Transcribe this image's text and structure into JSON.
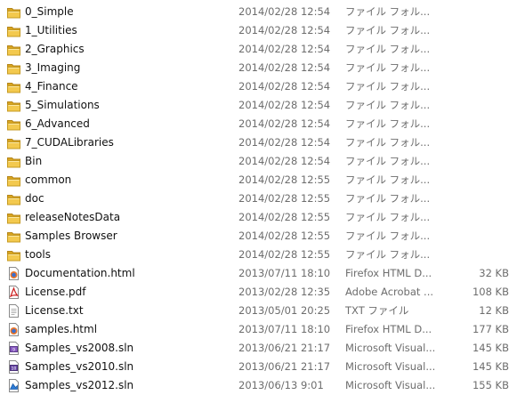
{
  "files": [
    {
      "name": "0_Simple",
      "date": "2014/02/28 12:54",
      "type": "ファイル フォル...",
      "size": "",
      "icon": "folder-icon"
    },
    {
      "name": "1_Utilities",
      "date": "2014/02/28 12:54",
      "type": "ファイル フォル...",
      "size": "",
      "icon": "folder-icon"
    },
    {
      "name": "2_Graphics",
      "date": "2014/02/28 12:54",
      "type": "ファイル フォル...",
      "size": "",
      "icon": "folder-icon"
    },
    {
      "name": "3_Imaging",
      "date": "2014/02/28 12:54",
      "type": "ファイル フォル...",
      "size": "",
      "icon": "folder-icon"
    },
    {
      "name": "4_Finance",
      "date": "2014/02/28 12:54",
      "type": "ファイル フォル...",
      "size": "",
      "icon": "folder-icon"
    },
    {
      "name": "5_Simulations",
      "date": "2014/02/28 12:54",
      "type": "ファイル フォル...",
      "size": "",
      "icon": "folder-icon"
    },
    {
      "name": "6_Advanced",
      "date": "2014/02/28 12:54",
      "type": "ファイル フォル...",
      "size": "",
      "icon": "folder-icon"
    },
    {
      "name": "7_CUDALibraries",
      "date": "2014/02/28 12:54",
      "type": "ファイル フォル...",
      "size": "",
      "icon": "folder-icon"
    },
    {
      "name": "Bin",
      "date": "2014/02/28 12:54",
      "type": "ファイル フォル...",
      "size": "",
      "icon": "folder-icon"
    },
    {
      "name": "common",
      "date": "2014/02/28 12:55",
      "type": "ファイル フォル...",
      "size": "",
      "icon": "folder-icon"
    },
    {
      "name": "doc",
      "date": "2014/02/28 12:55",
      "type": "ファイル フォル...",
      "size": "",
      "icon": "folder-icon"
    },
    {
      "name": "releaseNotesData",
      "date": "2014/02/28 12:55",
      "type": "ファイル フォル...",
      "size": "",
      "icon": "folder-icon"
    },
    {
      "name": "Samples Browser",
      "date": "2014/02/28 12:55",
      "type": "ファイル フォル...",
      "size": "",
      "icon": "folder-icon"
    },
    {
      "name": "tools",
      "date": "2014/02/28 12:55",
      "type": "ファイル フォル...",
      "size": "",
      "icon": "folder-icon"
    },
    {
      "name": "Documentation.html",
      "date": "2013/07/11 18:10",
      "type": "Firefox HTML D...",
      "size": "32 KB",
      "icon": "html-file-icon"
    },
    {
      "name": "License.pdf",
      "date": "2013/02/28 12:35",
      "type": "Adobe Acrobat ...",
      "size": "108 KB",
      "icon": "pdf-file-icon"
    },
    {
      "name": "License.txt",
      "date": "2013/05/01 20:25",
      "type": "TXT ファイル",
      "size": "12 KB",
      "icon": "txt-file-icon"
    },
    {
      "name": "samples.html",
      "date": "2013/07/11 18:10",
      "type": "Firefox HTML D...",
      "size": "177 KB",
      "icon": "html-file-icon"
    },
    {
      "name": "Samples_vs2008.sln",
      "date": "2013/06/21 21:17",
      "type": "Microsoft Visual...",
      "size": "145 KB",
      "icon": "vs2008-sln-icon"
    },
    {
      "name": "Samples_vs2010.sln",
      "date": "2013/06/21 21:17",
      "type": "Microsoft Visual...",
      "size": "145 KB",
      "icon": "vs2010-sln-icon"
    },
    {
      "name": "Samples_vs2012.sln",
      "date": "2013/06/13 9:01",
      "type": "Microsoft Visual...",
      "size": "155 KB",
      "icon": "vs2012-sln-icon"
    }
  ]
}
